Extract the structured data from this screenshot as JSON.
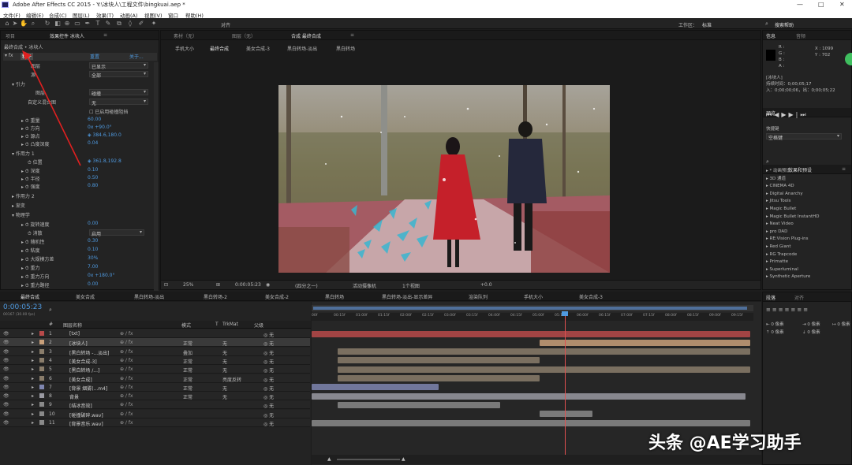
{
  "window": {
    "title": "Adobe After Effects CC 2015 - Y:\\冰块人\\工程文件\\bingkuai.aep *",
    "controls": [
      "—",
      "□",
      "✕"
    ]
  },
  "menu": [
    "文件(F)",
    "编辑(E)",
    "合成(C)",
    "图层(L)",
    "效果(T)",
    "动画(A)",
    "视图(V)",
    "窗口",
    "帮助(H)"
  ],
  "toolbar": {
    "snap_label": "对齐",
    "workspace_label": "工作区：",
    "workspace_value": "标准",
    "search_placeholder": "搜索帮助"
  },
  "effect_panel": {
    "tabs": [
      "项目",
      "效果控件 冰块人",
      "≡"
    ],
    "breadcrumb": "最终合成 • 冰块人",
    "header": {
      "name": "粒子",
      "reset": "重置",
      "about": "关于..."
    },
    "rows": [
      {
        "label": "图层",
        "value": "已显示"
      },
      {
        "label": "源",
        "value": "全部"
      },
      {
        "label": "引力",
        "value": ""
      },
      {
        "label": "图层",
        "value": "碰撞"
      },
      {
        "label": "自定义混合图",
        "value": "无"
      },
      {
        "label": "",
        "value": "已启用碰撞阻挡"
      },
      {
        "label": "重量",
        "value": "60.00"
      },
      {
        "label": "方向",
        "value": "0x +90.0°"
      },
      {
        "label": "源点",
        "value": "◈ 384.6,180.0"
      },
      {
        "label": "凸度深度",
        "value": "0.04"
      },
      {
        "label": "作用力 1",
        "value": ""
      },
      {
        "label": "位置",
        "value": "◈ 361.8,192.8"
      },
      {
        "label": "深度",
        "value": "0.10"
      },
      {
        "label": "半径",
        "value": "0.50"
      },
      {
        "label": "强度",
        "value": "0.80"
      },
      {
        "label": "作用力 2",
        "value": ""
      },
      {
        "label": "渐变",
        "value": ""
      },
      {
        "label": "物理学",
        "value": ""
      },
      {
        "label": "旋转速度",
        "value": "0.00"
      },
      {
        "label": "消散",
        "value": "启用"
      },
      {
        "label": "随机性",
        "value": "0.30"
      },
      {
        "label": "粘度",
        "value": "0.10"
      },
      {
        "label": "大规模方差",
        "value": "30%"
      },
      {
        "label": "重力",
        "value": "7.00"
      },
      {
        "label": "重力方向",
        "value": "0x +180.0°"
      },
      {
        "label": "重力路径",
        "value": "0.00"
      }
    ]
  },
  "comp_panel": {
    "tabs": [
      "素材（无）",
      "图层（无）",
      "合成 最终合成",
      "≡"
    ],
    "breadcrumbs": [
      "手机大小",
      "最终合成",
      "美女合成-3",
      "黑白转场-淡出",
      "黑白转场"
    ],
    "footer": {
      "zoom": "25%",
      "timecode": "0:00:05:23",
      "resolution": "(四分之一)",
      "camera": "活动摄像机",
      "views": "1个视图",
      "offset": "+0.0"
    }
  },
  "info_panel": {
    "tabs": [
      "信息",
      "音频"
    ],
    "r": "R :",
    "g": "G :",
    "b": "B :",
    "a": "A :",
    "x": "X : 1099",
    "y": "Y : 702",
    "layer": "[冰块人]",
    "duration": "持续时间：0;00;05;17",
    "inout": "入：0;00;00;06，出：0;00;05;22",
    "preview_tab": "预览",
    "shortcut_label": "快捷键",
    "shortcut_value": "空格键",
    "effects_tabs": [
      "效果和预设",
      "≡"
    ],
    "effects_list": [
      "* 动画预设",
      "3D 通道",
      "CINEMA 4D",
      "Digital Anarchy",
      "Jitsu Tools",
      "Magic Bullet",
      "Magic Bullet InstantHD",
      "Neat Video",
      "pro DAD",
      "RE:Vision Plug-ins",
      "Red Giant",
      "RG Trapcode",
      "Primatte",
      "Superluminal",
      "Synthetic Aperture"
    ]
  },
  "timeline_tabs": [
    "最终合成",
    "美女合成",
    "黑白转场-淡出",
    "黑白转场-2",
    "美女合成-2",
    "黑白转场",
    "黑白转场-淡出-显示差异",
    "渲染队列",
    "手机大小",
    "美女合成-3"
  ],
  "timeline": {
    "timecode": "0:00:05:23",
    "fps": "00167 (30.00 fps)",
    "headers": [
      "#",
      "图层名称",
      "模式",
      "T",
      "TrkMat",
      "父级"
    ],
    "layers": [
      {
        "num": "1",
        "name": "[txt]",
        "mode": "",
        "trk": "",
        "parent": "无",
        "color": "#b84a4a"
      },
      {
        "num": "2",
        "name": "[冰块人]",
        "mode": "正常",
        "trk": "无",
        "parent": "无",
        "color": "#c9a07a"
      },
      {
        "num": "3",
        "name": "[黑白转场 -...淡出]",
        "mode": "叠加",
        "trk": "无",
        "parent": "无",
        "color": "#8a7d6b"
      },
      {
        "num": "4",
        "name": "[美女合成-3]",
        "mode": "正常",
        "trk": "无",
        "parent": "无",
        "color": "#8a7d6b"
      },
      {
        "num": "5",
        "name": "[黑白转场 /...]",
        "mode": "正常",
        "trk": "无",
        "parent": "无",
        "color": "#8a7d6b"
      },
      {
        "num": "6",
        "name": "[美女合成]",
        "mode": "正常",
        "trk": "亮度反转",
        "parent": "无",
        "color": "#8a7d6b"
      },
      {
        "num": "7",
        "name": "[背景 烟雾(...m4]",
        "mode": "正常",
        "trk": "无",
        "parent": "无",
        "color": "#7f86b0"
      },
      {
        "num": "8",
        "name": "背景",
        "mode": "正常",
        "trk": "无",
        "parent": "无",
        "color": "#9a9aa2"
      },
      {
        "num": "9",
        "name": "[结冰音效]",
        "mode": "",
        "trk": "",
        "parent": "无",
        "color": "#8a8a8a"
      },
      {
        "num": "10",
        "name": "[碰撞破碎.wav]",
        "mode": "",
        "trk": "",
        "parent": "无",
        "color": "#8a8a8a"
      },
      {
        "num": "11",
        "name": "[背景音乐.wav]",
        "mode": "",
        "trk": "",
        "parent": "无",
        "color": "#8a8a8a"
      }
    ],
    "ruler": [
      "00f",
      "00:15f",
      "01:00f",
      "01:15f",
      "02:00f",
      "02:15f",
      "03:00f",
      "03:15f",
      "04:00f",
      "04:15f",
      "05:00f",
      "05:15f",
      "06:00f",
      "06:15f",
      "07:00f",
      "07:15f",
      "08:00f",
      "08:15f",
      "09:00f",
      "09:15f"
    ]
  },
  "paragraph_panel": {
    "tabs": [
      "段落",
      "对齐"
    ],
    "values": [
      "0 像素",
      "0 像素",
      "0 像素",
      "0 像素",
      "0 像素"
    ]
  },
  "watermark": "头条 @AE学习助手",
  "colors": {
    "accent": "#4f9ae0",
    "playhead": "#e05050",
    "panel": "#232323"
  }
}
